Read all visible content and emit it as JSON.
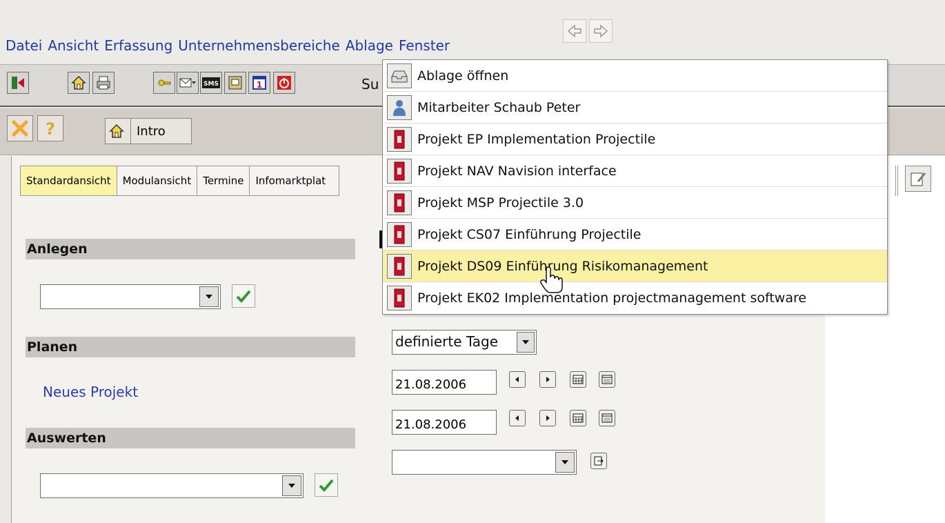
{
  "menubar": {
    "items": [
      "Datei",
      "Ansicht",
      "Erfassung",
      "Unternehmensbereiche",
      "Ablage",
      "Fenster"
    ],
    "back_icon": "arrow-left-icon",
    "forward_icon": "arrow-right-icon"
  },
  "toolbar": {
    "label": "Su",
    "icons": [
      "exit-icon",
      "home-icon",
      "print-icon",
      "key-icon",
      "mail-icon",
      "sms-icon",
      "window-icon",
      "calendar-icon",
      "power-icon"
    ]
  },
  "window": {
    "intro_label": "Intro"
  },
  "tabs": [
    "Standardansicht",
    "Modulansicht",
    "Termine",
    "Infomarktplat"
  ],
  "sections": {
    "anlegen": "Anlegen",
    "planen": "Planen",
    "auswerten": "Auswerten"
  },
  "planen_link": "Neues Projekt",
  "form": {
    "days_select": "definierte Tage",
    "date_from": "21.08.2006",
    "date_to": "21.08.2006"
  },
  "dropdown": {
    "items": [
      {
        "label": "Ablage öffnen",
        "icon": "tray-icon"
      },
      {
        "label": "Mitarbeiter Schaub Peter",
        "icon": "person-icon"
      },
      {
        "label": "Projekt EP Implementation Projectile",
        "icon": "project-icon"
      },
      {
        "label": "Projekt NAV Navision interface",
        "icon": "project-icon"
      },
      {
        "label": "Projekt MSP Projectile 3.0",
        "icon": "project-icon"
      },
      {
        "label": "Projekt CS07 Einführung Projectile",
        "icon": "project-icon"
      },
      {
        "label": "Projekt DS09 Einführung Risikomanagement",
        "icon": "project-icon"
      },
      {
        "label": "Projekt EK02 Implementation projectmanagement software",
        "icon": "project-icon"
      }
    ],
    "highlighted_index": 6
  },
  "colors": {
    "menu_text": "#1f3aa8",
    "highlight": "#fbf1a3",
    "active_tab": "#fbf3a6"
  }
}
